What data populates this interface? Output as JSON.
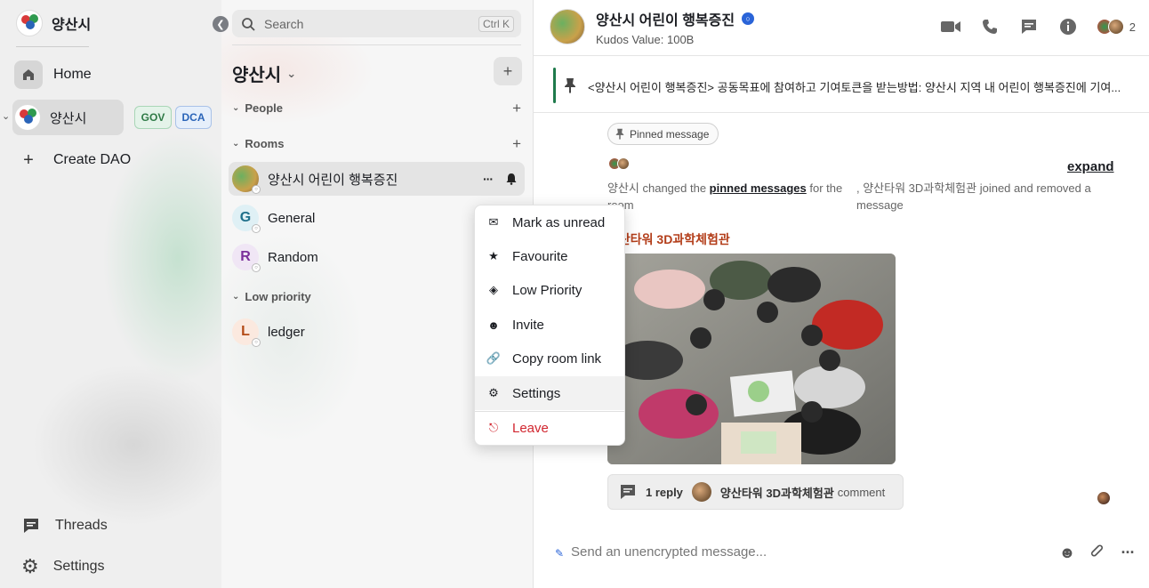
{
  "spaces": {
    "app_title": "양산시",
    "logo_caption": "양산시",
    "home_label": "Home",
    "space_label": "양산시",
    "badges": [
      "GOV",
      "DCA"
    ],
    "create_label": "Create DAO",
    "threads_label": "Threads",
    "settings_label": "Settings"
  },
  "roomlist": {
    "search_placeholder": "Search",
    "search_shortcut": "Ctrl K",
    "space_name": "양산시",
    "sections": {
      "people": "People",
      "rooms": "Rooms",
      "low_priority": "Low priority"
    },
    "rooms": [
      {
        "name": "양산시 어린이 행복증진",
        "avatar_letter": ""
      },
      {
        "name": "General",
        "avatar_letter": "G"
      },
      {
        "name": "Random",
        "avatar_letter": "R"
      }
    ],
    "low_priority_rooms": [
      {
        "name": "ledger",
        "avatar_letter": "L"
      }
    ]
  },
  "context_menu": {
    "items": [
      {
        "label": "Mark as unread",
        "icon": "envelope-icon"
      },
      {
        "label": "Favourite",
        "icon": "star-icon"
      },
      {
        "label": "Low Priority",
        "icon": "low-priority-icon"
      },
      {
        "label": "Invite",
        "icon": "invite-icon"
      },
      {
        "label": "Copy room link",
        "icon": "link-icon"
      },
      {
        "label": "Settings",
        "icon": "gear-icon"
      },
      {
        "label": "Leave",
        "icon": "leave-icon"
      }
    ]
  },
  "room": {
    "title": "양산시 어린이 행복증진",
    "subtitle": "Kudos Value: 100B",
    "member_count": "2",
    "pinned_text": "<양산시 어린이 행복증진> 공동목표에 참여하고 기여토큰을 받는방법: 양산시 지역 내 어린이 행복증진에 기여...",
    "pinned_chip": "Pinned message",
    "expand_label": "expand",
    "system_event_prefix": "양산시 changed the ",
    "system_event_link": "pinned messages",
    "system_event_suffix": " for the room",
    "system_event_2": ", 양산타워 3D과학체험관 joined and removed a message",
    "sender": "양산타워 3D과학체험관",
    "thread_reply_count": "1 reply",
    "thread_author": "양산타워 3D과학체험관",
    "thread_preview": "comment",
    "composer_placeholder": "Send an unencrypted message..."
  },
  "colors": {
    "accent_green": "#1f7a4c",
    "danger": "#d1262f",
    "sender": "#b33e1a",
    "gov_badge": "#2f7a46",
    "dca_badge": "#2a64b8"
  }
}
